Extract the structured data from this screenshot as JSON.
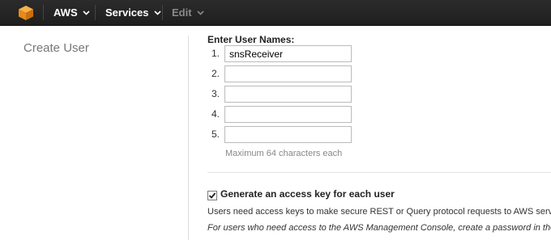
{
  "topbar": {
    "logo_icon": "aws-cube-icon",
    "aws_label": "AWS",
    "services_label": "Services",
    "edit_label": "Edit"
  },
  "page": {
    "title": "Create User"
  },
  "form": {
    "heading": "Enter User Names:",
    "rows": [
      {
        "number": "1.",
        "value": "snsReceiver"
      },
      {
        "number": "2.",
        "value": ""
      },
      {
        "number": "3.",
        "value": ""
      },
      {
        "number": "4.",
        "value": ""
      },
      {
        "number": "5.",
        "value": ""
      }
    ],
    "hint": "Maximum 64 characters each",
    "generate_key": {
      "checked": true,
      "label": "Generate an access key for each user"
    },
    "info_text": "Users need access keys to make secure REST or Query protocol requests to AWS service",
    "info_italic": "For users who need access to the AWS Management Console, create a password in the U"
  },
  "colors": {
    "topbar_bg": "#1f1f1f",
    "logo_orange": "#f7981d"
  }
}
